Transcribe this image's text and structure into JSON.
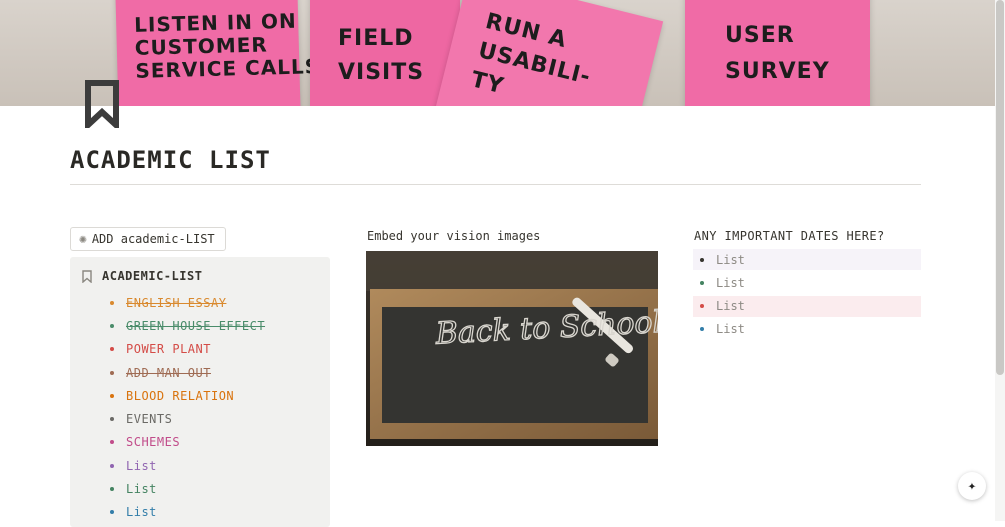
{
  "cover": {
    "notes": [
      "LISTEN IN ON\nCUSTOMER\nSERVICE CALLS",
      "FIELD\nVISITS",
      "RUN A\nUSABILI-\nTY",
      "USER\nSURVEY"
    ]
  },
  "page": {
    "icon": "bookmark-icon",
    "title": "ACADEMIC LIST"
  },
  "add_button": {
    "icon": "sparkle-icon",
    "label": "ADD academic-LIST"
  },
  "callout": {
    "icon": "bookmark-icon",
    "heading": "ACADEMIC-LIST",
    "items": [
      {
        "label": "ENGLISH ESSAY",
        "color": "#d9892e",
        "done": true
      },
      {
        "label": "GREEN HOUSE EFFECT",
        "color": "#4a8c6a",
        "done": true
      },
      {
        "label": "POWER PLANT",
        "color": "#d44c47",
        "done": false
      },
      {
        "label": "ADD MAN OUT",
        "color": "#9f6b53",
        "done": true
      },
      {
        "label": "BLOOD RELATION",
        "color": "#d9730d",
        "done": false
      },
      {
        "label": "EVENTS",
        "color": "#6b6a66",
        "done": false
      },
      {
        "label": "SCHEMES",
        "color": "#c14c8a",
        "done": false
      },
      {
        "label": "List",
        "color": "#9065b0",
        "done": false
      },
      {
        "label": "List",
        "color": "#448361",
        "done": false
      },
      {
        "label": "List",
        "color": "#337ea9",
        "done": false
      }
    ]
  },
  "vision": {
    "label": "Embed your vision images",
    "image_text": "Back to School"
  },
  "dates": {
    "label": "ANY IMPORTANT DATES HERE?",
    "items": [
      {
        "label": "List",
        "bullet": "#37352f",
        "bg": "#f6f3f9"
      },
      {
        "label": "List",
        "bullet": "#448361",
        "bg": "#ffffff"
      },
      {
        "label": "List",
        "bullet": "#d44c47",
        "bg": "#fbecee"
      },
      {
        "label": "List",
        "bullet": "#337ea9",
        "bg": "#ffffff"
      }
    ]
  },
  "ai_button": {
    "icon": "sparkle-icon",
    "label": "✦"
  }
}
